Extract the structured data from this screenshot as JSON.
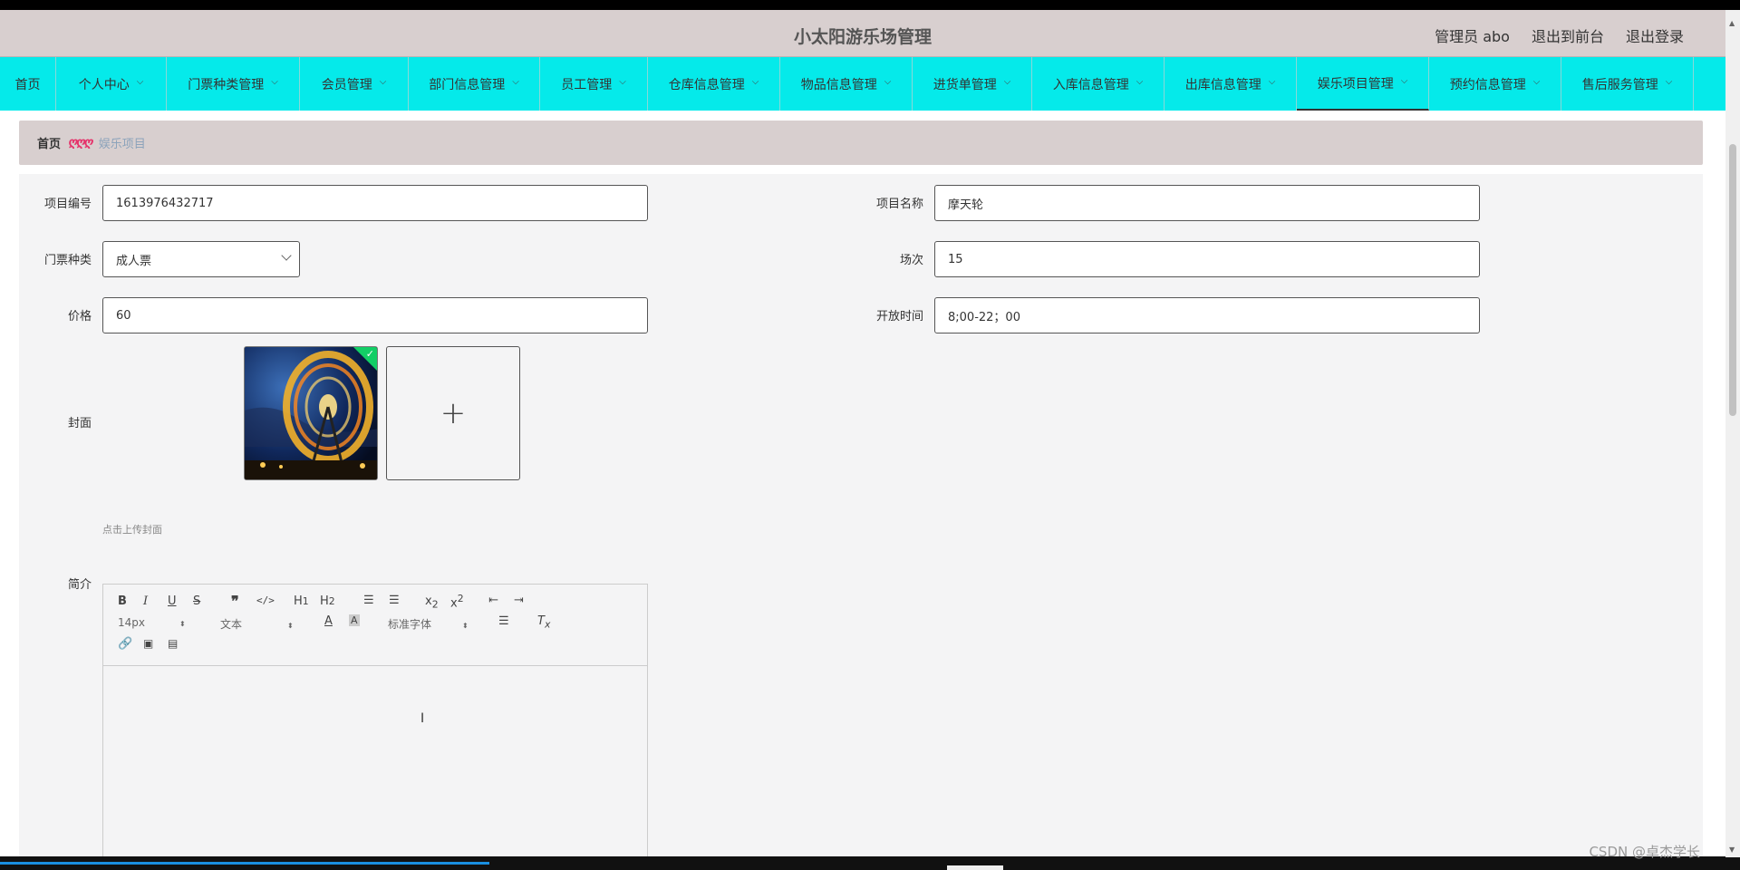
{
  "app": {
    "title": "小太阳游乐场管理"
  },
  "user": {
    "name": "管理员 abo",
    "to_frontend": "退出到前台",
    "logout": "退出登录"
  },
  "nav": [
    {
      "label": "首页",
      "has_menu": false
    },
    {
      "label": "个人中心",
      "has_menu": true
    },
    {
      "label": "门票种类管理",
      "has_menu": true
    },
    {
      "label": "会员管理",
      "has_menu": true
    },
    {
      "label": "部门信息管理",
      "has_menu": true
    },
    {
      "label": "员工管理",
      "has_menu": true
    },
    {
      "label": "仓库信息管理",
      "has_menu": true
    },
    {
      "label": "物品信息管理",
      "has_menu": true
    },
    {
      "label": "进货单管理",
      "has_menu": true
    },
    {
      "label": "入库信息管理",
      "has_menu": true
    },
    {
      "label": "出库信息管理",
      "has_menu": true
    },
    {
      "label": "娱乐项目管理",
      "has_menu": true,
      "active": true
    },
    {
      "label": "预约信息管理",
      "has_menu": true
    },
    {
      "label": "售后服务管理",
      "has_menu": true
    }
  ],
  "breadcrumb": {
    "home": "首页",
    "current": "娱乐项目"
  },
  "form": {
    "code_label": "项目编号",
    "code_value": "1613976432717",
    "name_label": "项目名称",
    "name_value": "摩天轮",
    "ticket_label": "门票种类",
    "ticket_value": "成人票",
    "sessions_label": "场次",
    "sessions_value": "15",
    "price_label": "价格",
    "price_value": "60",
    "hours_label": "开放时间",
    "hours_value": "8;00-22；00",
    "cover_label": "封面",
    "cover_hint": "点击上传封面",
    "intro_label": "简介"
  },
  "editor": {
    "size": "14px",
    "style": "文本",
    "font": "标准字体"
  },
  "watermark": "CSDN @卓杰学长",
  "colors": {
    "nav_bg": "#05eaea",
    "header_bg": "#d8cfcf",
    "accent": "#e5336b"
  }
}
